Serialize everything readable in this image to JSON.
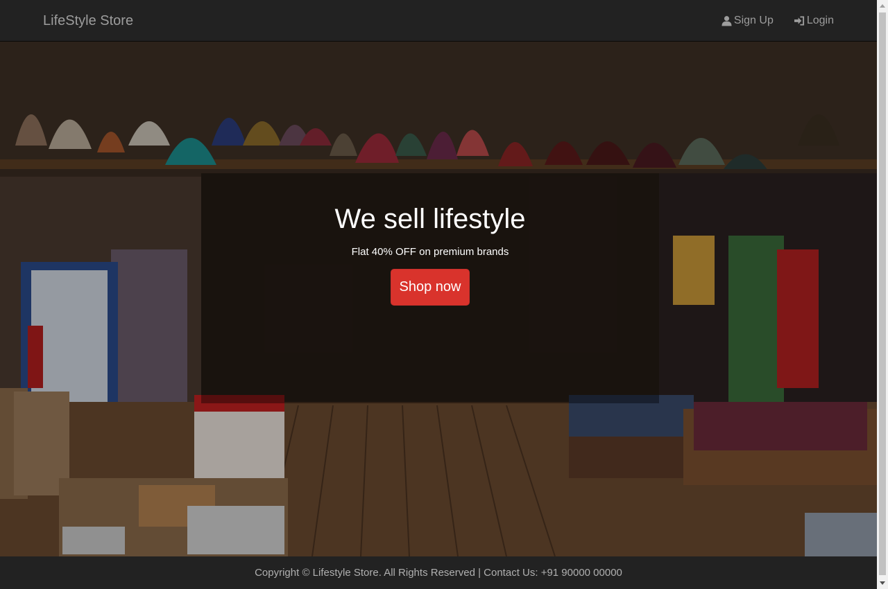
{
  "navbar": {
    "brand": "LifeStyle Store",
    "signup_label": "Sign Up",
    "login_label": "Login",
    "signup_icon": "user-icon",
    "login_icon": "login-icon"
  },
  "hero": {
    "title": "We sell lifestyle",
    "subtitle": "Flat 40% OFF on premium brands",
    "button_label": "Shop now",
    "button_color": "#d9332c",
    "image_description_icon": "market-shop-photo"
  },
  "footer": {
    "text": "Copyright © Lifestyle Store. All Rights Reserved | Contact Us: +91 90000 00000"
  },
  "colors": {
    "navbar_bg": "#222222",
    "nav_text": "#9d9d9d",
    "footer_text": "#b0b0b0"
  }
}
